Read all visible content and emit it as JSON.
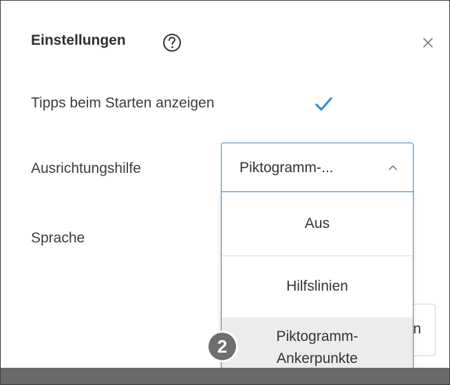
{
  "dialog": {
    "title": "Einstellungen",
    "help_icon": "question-circle-icon",
    "close_icon": "close-icon"
  },
  "settings": {
    "tips_label": "Tipps beim Starten anzeigen",
    "tips_checked": true,
    "alignment_label": "Ausrichtungshilfe",
    "alignment_value": "Piktogramm-...",
    "language_label": "Sprache"
  },
  "dropdown": {
    "options": [
      "Aus",
      "Hilfslinien",
      "Piktogramm-\nAnkerpunkte"
    ],
    "option_line1": "Piktogramm-",
    "option_line2": "Ankerpunkte",
    "highlighted_index": 2
  },
  "background_button_text": "n",
  "step_badge": "2",
  "colors": {
    "accent": "#3e86b6",
    "checkmark": "#2f8fd6",
    "badge": "#6f6f6f"
  }
}
